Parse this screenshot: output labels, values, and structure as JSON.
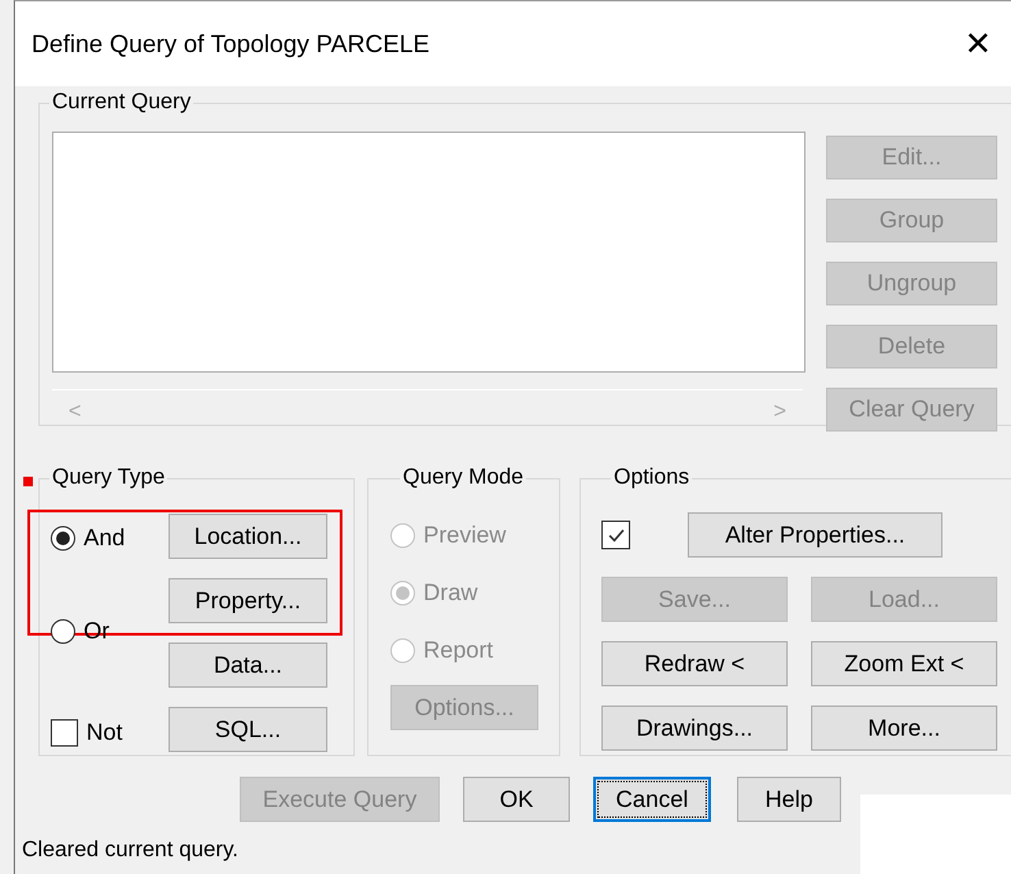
{
  "window": {
    "title": "Define Query of Topology PARCELE",
    "close": "✕"
  },
  "current_query": {
    "label": "Current Query",
    "scroll_left": "<",
    "scroll_right": ">",
    "buttons": [
      {
        "label": "Edit...",
        "disabled": true
      },
      {
        "label": "Group",
        "disabled": true
      },
      {
        "label": "Ungroup",
        "disabled": true
      },
      {
        "label": "Delete",
        "disabled": true
      },
      {
        "label": "Clear Query",
        "disabled": true
      }
    ]
  },
  "query_type": {
    "label": "Query Type",
    "radios": [
      {
        "label": "And",
        "selected": true
      },
      {
        "label": "Or",
        "selected": false
      }
    ],
    "not": {
      "label": "Not",
      "checked": false
    },
    "buttons": [
      {
        "label": "Location...",
        "disabled": false
      },
      {
        "label": "Property...",
        "disabled": false
      },
      {
        "label": "Data...",
        "disabled": false
      },
      {
        "label": "SQL...",
        "disabled": false
      }
    ]
  },
  "query_mode": {
    "label": "Query Mode",
    "disabled": true,
    "radios": [
      {
        "label": "Preview",
        "selected": false
      },
      {
        "label": "Draw",
        "selected": true
      },
      {
        "label": "Report",
        "selected": false
      }
    ],
    "button": {
      "label": "Options...",
      "disabled": true
    }
  },
  "options": {
    "label": "Options",
    "checkbox": {
      "checked": true
    },
    "alter": {
      "label": "Alter Properties...",
      "disabled": false
    },
    "buttons": [
      {
        "label": "Save...",
        "disabled": true
      },
      {
        "label": "Load...",
        "disabled": true
      },
      {
        "label": "Redraw <",
        "disabled": false
      },
      {
        "label": "Zoom Ext <",
        "disabled": false
      },
      {
        "label": "Drawings...",
        "disabled": false
      },
      {
        "label": "More...",
        "disabled": false
      }
    ]
  },
  "footer_buttons": [
    {
      "label": "Execute Query",
      "disabled": true,
      "focused": false
    },
    {
      "label": "OK",
      "disabled": false,
      "focused": false
    },
    {
      "label": "Cancel",
      "disabled": false,
      "focused": true
    },
    {
      "label": "Help",
      "disabled": false,
      "focused": false
    }
  ],
  "status_bar": "Cleared current query."
}
